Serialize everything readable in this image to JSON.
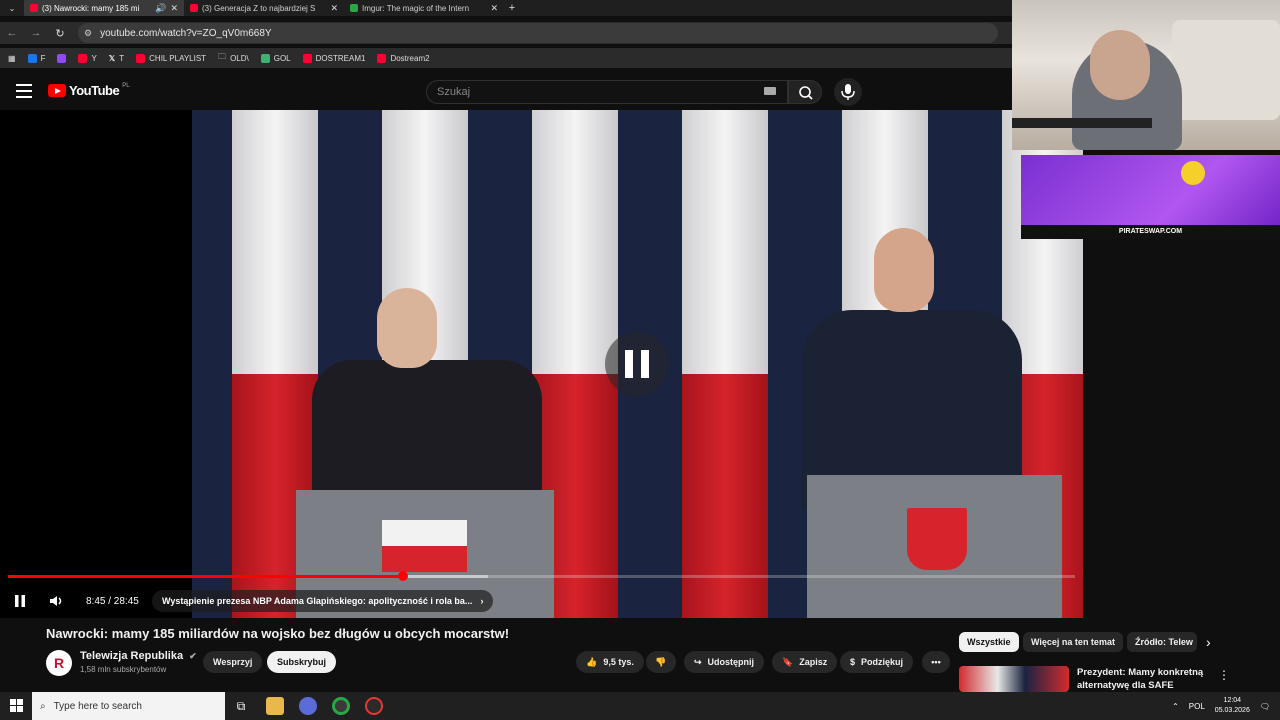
{
  "browser": {
    "tabs": [
      {
        "title": "(3) Nawrocki: mamy 185 mi",
        "active": true,
        "favicon": "youtube-icon"
      },
      {
        "title": "(3) Generacja Z to najbardziej S",
        "active": false,
        "favicon": "youtube-icon"
      },
      {
        "title": "Imgur: The magic of the Intern",
        "active": false,
        "favicon": "imgur-icon"
      }
    ],
    "url": "youtube.com/watch?v=ZO_qV0m668Y",
    "bookmarks": [
      {
        "label": "F",
        "icon": "facebook-icon",
        "color": "#1877f2"
      },
      {
        "label": "",
        "icon": "twitch-icon",
        "color": "#9146ff"
      },
      {
        "label": "Y",
        "icon": "youtube-icon",
        "color": "#ff0033"
      },
      {
        "label": "T",
        "icon": "x-icon",
        "color": "#ffffff"
      },
      {
        "label": "CHIL PLAYLIST",
        "icon": "youtube-icon",
        "color": "#ff0033"
      },
      {
        "label": "OLD\\",
        "icon": "folder-icon",
        "color": "#dddddd"
      },
      {
        "label": "GOL",
        "icon": "gol-icon",
        "color": "#3cb371"
      },
      {
        "label": "DOSTREAM1",
        "icon": "youtube-icon",
        "color": "#ff0033"
      },
      {
        "label": "Dostream2",
        "icon": "youtube-icon",
        "color": "#ff0033"
      }
    ]
  },
  "youtube": {
    "logo_text": "YouTube",
    "country_code": "PL",
    "search_placeholder": "Szukaj"
  },
  "player": {
    "time": "8:45 / 28:45",
    "chapter": "Wystąpienie prezesa NBP Adama Glapińskiego: apolityczność i rola ba...",
    "progress": 0.37,
    "buffered": 0.45
  },
  "banner": {
    "text": "PIRATESWAP.COM"
  },
  "video": {
    "title": "Nawrocki: mamy 185 miliardów na wojsko bez długów u obcych mocarstw!",
    "channel": "Telewizja Republika",
    "subscribers": "1,58 mln subskrybentów",
    "support_label": "Wesprzyj",
    "subscribe_label": "Subskrybuj",
    "likes": "9,5 tys.",
    "share_label": "Udostępnij",
    "save_label": "Zapisz",
    "thanks_label": "Podziękuj"
  },
  "chips": [
    "Wszystkie",
    "Więcej na ten temat",
    "Źródło: Telew"
  ],
  "recommendation": {
    "title": "Prezydent: Mamy konkretną alternatywę dla SAFE"
  },
  "taskbar": {
    "search_placeholder": "Type here to search",
    "language": "POL",
    "time": "12:04",
    "date": "05.03.2026"
  }
}
